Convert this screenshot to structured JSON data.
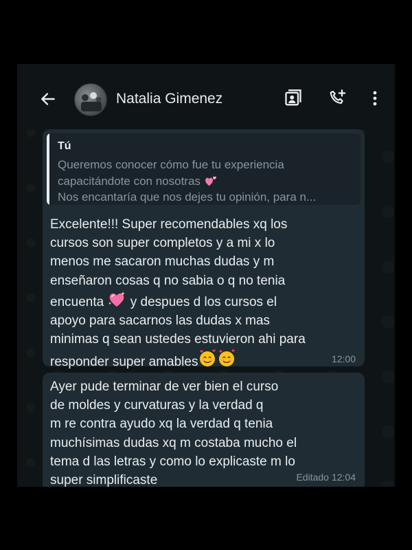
{
  "header": {
    "contact_name": "Natalia Gimenez"
  },
  "icons": {
    "back": "arrow-left-icon",
    "avatar": "contact-avatar",
    "contact_card": "contact-card-icon",
    "add_call": "phone-plus-icon",
    "more": "more-vertical-icon"
  },
  "messages": [
    {
      "quoted": {
        "author": "Tú",
        "text_line1": "Queremos conocer cómo fue tu experiencia",
        "text_line2": "capacitándote con nosotras",
        "text_line3": "Nos encantaría que nos dejes tu opinión, para n..."
      },
      "body_part1": "Excelente!!! Super recomendables xq los\ncursos son super completos y a mi x lo\nmenos me sacaron muchas dudas y m\nenseñaron cosas q no sabia o q no tenia\nencuenta ",
      "body_part2": " y despues d los cursos el\napoyo para sacarnos las dudas x mas\nminimas q sean ustedes estuvieron ahi para\nresponder super amables",
      "time": "12:00"
    },
    {
      "body": "Ayer pude terminar de ver bien el curso\nde moldes y curvaturas y la verdad q\nm re contra ayudo xq la verdad q tenia\nmuchísimas dudas xq m costaba mucho el\ntema d las letras y como lo explicaste m lo\nsuper simplificaste",
      "edited_label": "Editado",
      "time": "12:04"
    }
  ],
  "colors": {
    "background": "#0f1416",
    "bubble": "#1f2c33",
    "text": "#e9edef",
    "muted": "#8696a0"
  }
}
